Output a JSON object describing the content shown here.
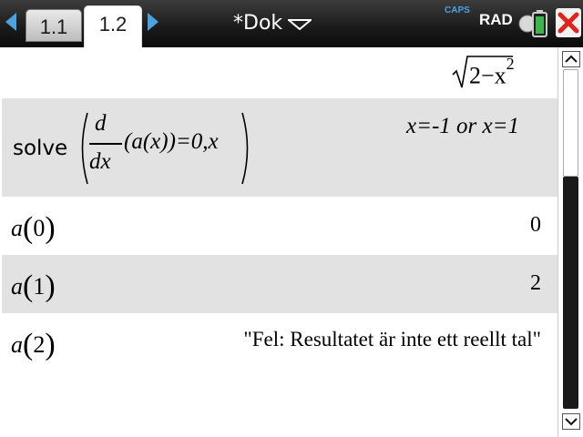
{
  "topbar": {
    "tabs": [
      {
        "label": "1.1",
        "active": false
      },
      {
        "label": "1.2",
        "active": true
      }
    ],
    "doc_title": "*Dok",
    "caps_indicator": "CAPS",
    "angle_mode": "RAD",
    "colors": {
      "accent": "#4aa3df",
      "close": "#e0241b",
      "battery": "#3db54a"
    }
  },
  "history": {
    "prev_output": {
      "radicand": "2−x",
      "exponent": "2"
    },
    "solve": {
      "func": "solve",
      "d": "d",
      "dx": "dx",
      "arg": "(a(x))=0,x",
      "result": "x=-1 or x=1"
    },
    "a0": {
      "func": "a",
      "arg": "0",
      "result": "0"
    },
    "a1": {
      "func": "a",
      "arg": "1",
      "result": "2"
    },
    "a2": {
      "func": "a",
      "arg": "2",
      "result": "\"Fel: Resultatet är inte ett reellt tal\""
    }
  }
}
